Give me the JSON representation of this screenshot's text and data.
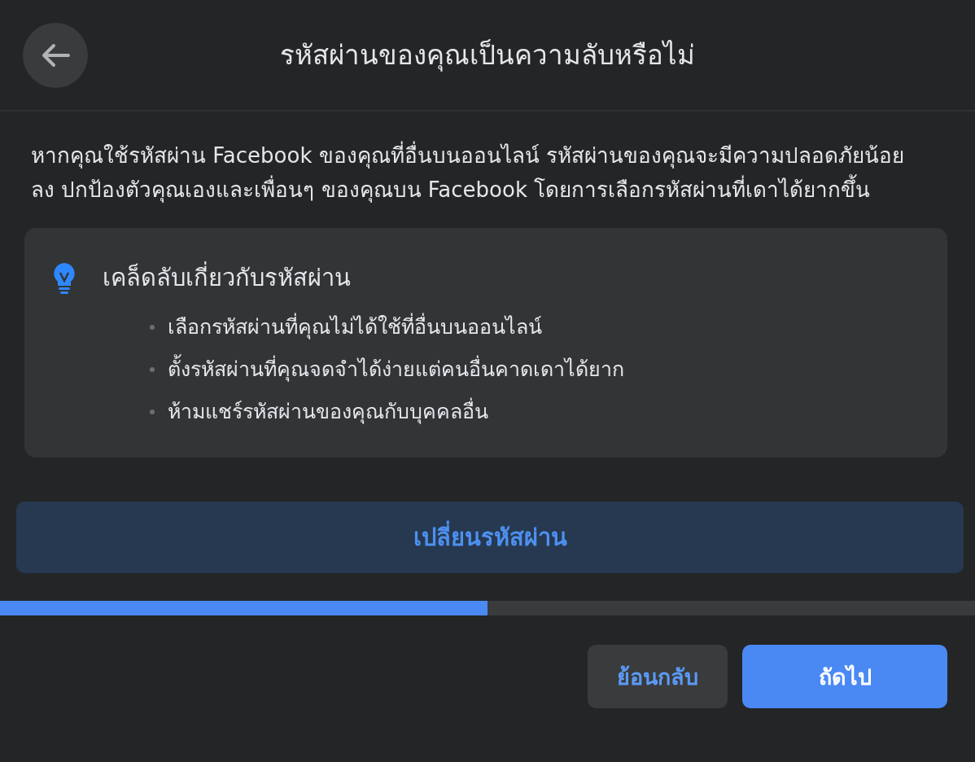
{
  "header": {
    "title": "รหัสผ่านของคุณเป็นความลับหรือไม่"
  },
  "intro": "หากคุณใช้รหัสผ่าน Facebook ของคุณที่อื่นบนออนไลน์ รหัสผ่านของคุณจะมีความปลอดภัยน้อยลง ปกป้องตัวคุณเองและเพื่อนๆ ของคุณบน Facebook โดยการเลือกรหัสผ่านที่เดาได้ยากขึ้น",
  "tips": {
    "title": "เคล็ดลับเกี่ยวกับรหัสผ่าน",
    "items": [
      "เลือกรหัสผ่านที่คุณไม่ได้ใช้ที่อื่นบนออนไลน์",
      "ตั้งรหัสผ่านที่คุณจดจำได้ง่ายแต่คนอื่นคาดเดาได้ยาก",
      "ห้ามแชร์รหัสผ่านของคุณกับบุคคลอื่น"
    ]
  },
  "change_password_button": "เปลี่ยนรหัสผ่าน",
  "progress": {
    "level": 0.5
  },
  "buttons": [
    {
      "label": "ย้อนกลับ",
      "kind": "secondary"
    },
    {
      "label": "ถัดไป",
      "kind": "primary"
    }
  ]
}
